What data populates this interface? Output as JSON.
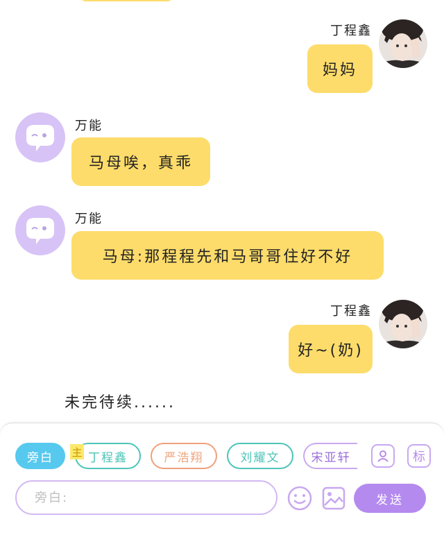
{
  "messages": [
    {
      "side": "right",
      "speaker": "丁程鑫",
      "text": "妈妈"
    },
    {
      "side": "left",
      "speaker": "万能",
      "text": "马母唉，真乖"
    },
    {
      "side": "left",
      "speaker": "万能",
      "text": "马母:那程程先和马哥哥住好不好"
    },
    {
      "side": "right",
      "speaker": "丁程鑫",
      "text": "好~(奶)"
    }
  ],
  "to_be_continued": "未完待续......",
  "roles": [
    {
      "label": "旁白",
      "color": "#57c9ee",
      "active": true
    },
    {
      "label": "丁程鑫",
      "color": "#4cc4b8",
      "active": false
    },
    {
      "label": "严浩翔",
      "color": "#f0a07a",
      "active": false
    },
    {
      "label": "刘耀文",
      "color": "#4cc4b8",
      "active": false
    },
    {
      "label": "宋亚轩",
      "color": "#c8a8f0",
      "active": false
    }
  ],
  "main_badge": "主",
  "tag_button": "标",
  "input": {
    "placeholder": "旁白:",
    "value": ""
  },
  "send_label": "发送",
  "colors": {
    "bubble": "#fddc6b",
    "accent": "#b58aef",
    "bot_avatar": "#d7c3f6"
  },
  "icons": [
    "person-icon",
    "tag-icon",
    "emoji-icon",
    "image-icon",
    "bot-avatar-icon"
  ]
}
